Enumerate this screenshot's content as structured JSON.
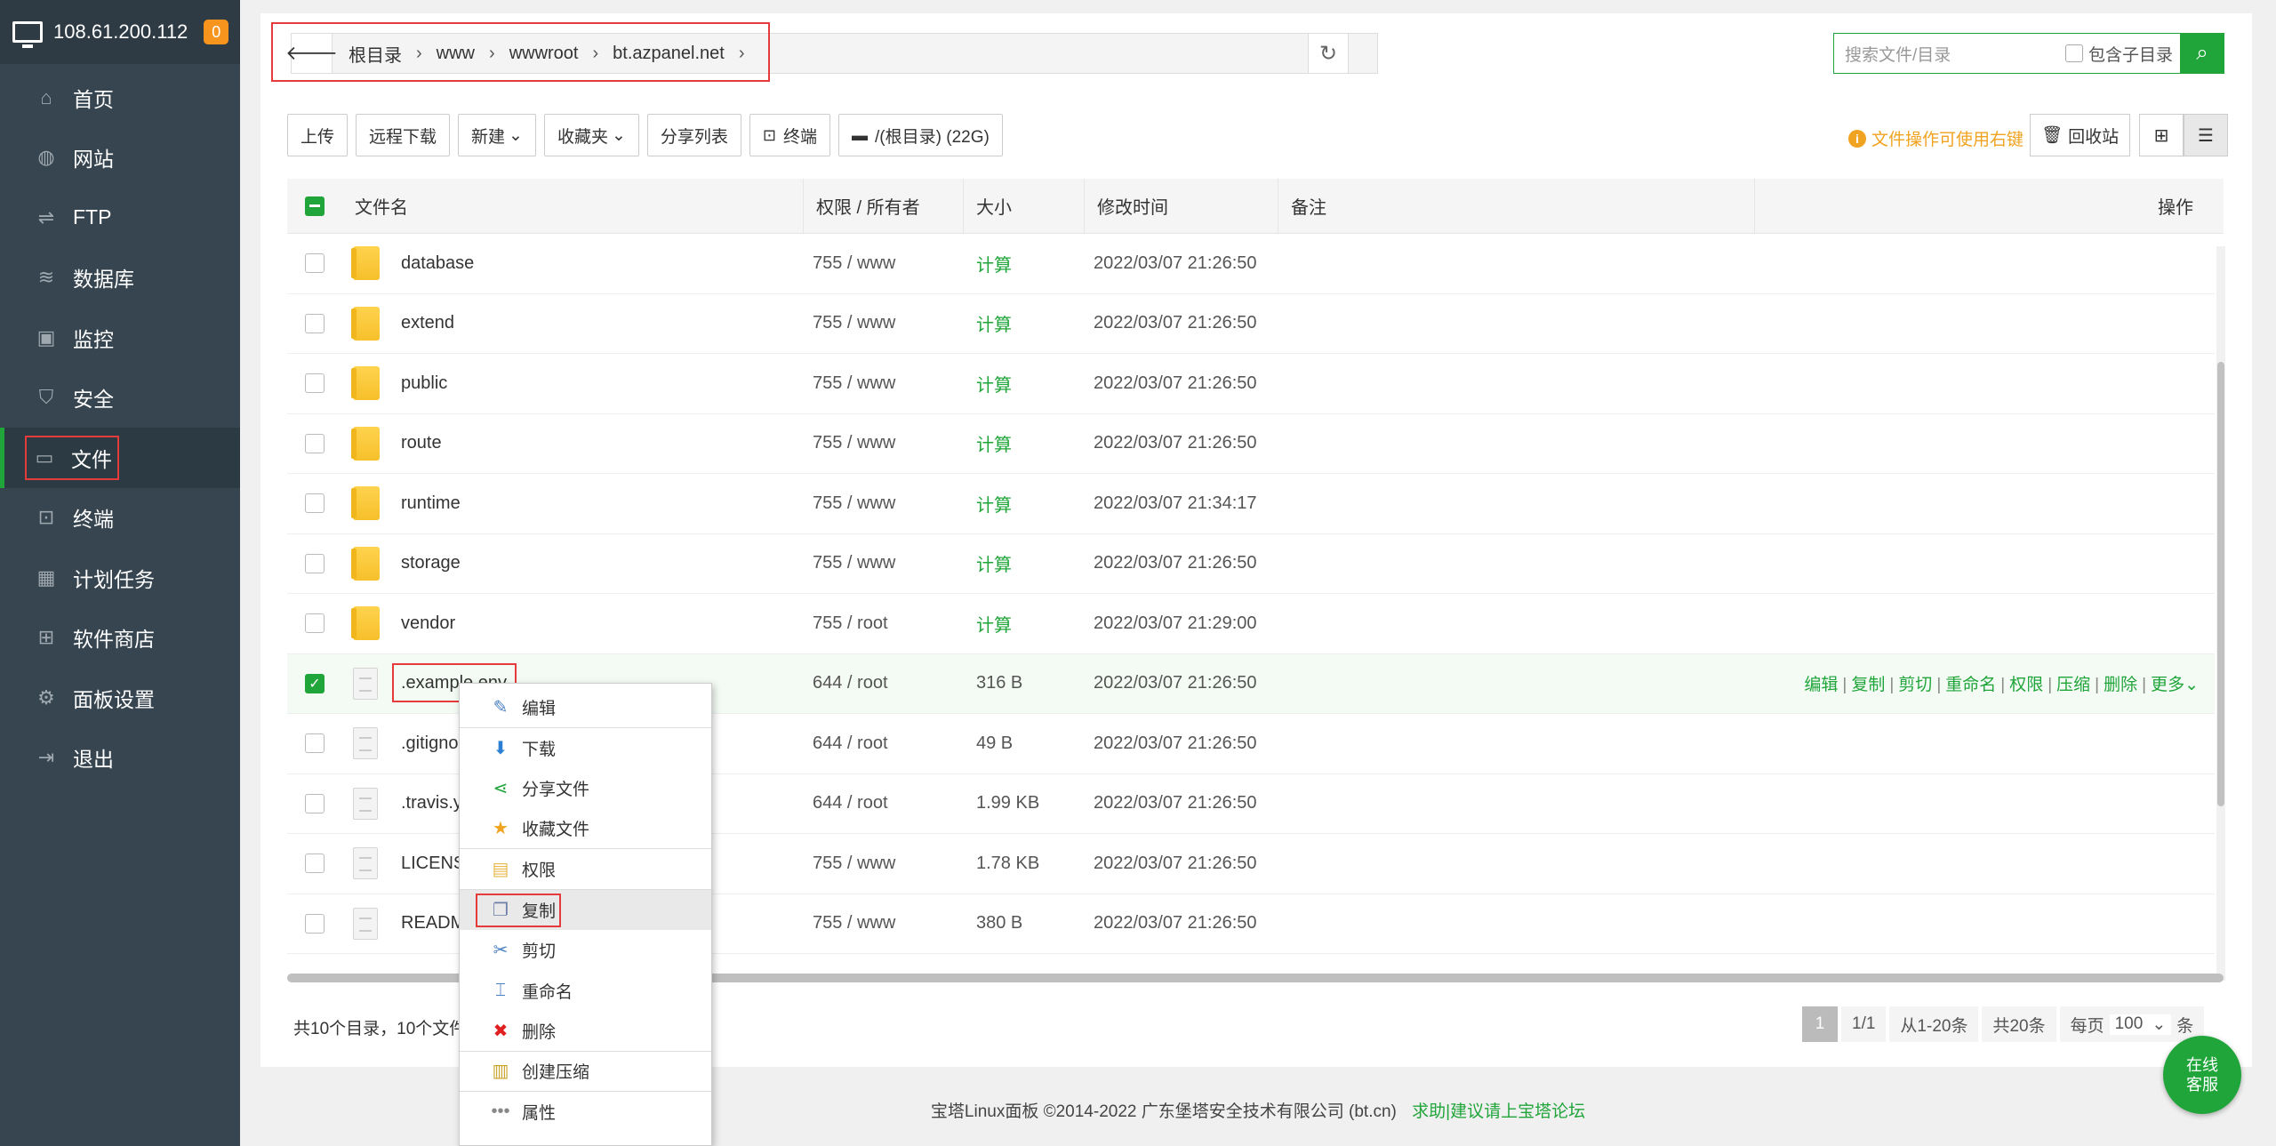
{
  "server": {
    "ip": "108.61.200.112",
    "badge": "0"
  },
  "sidebar": {
    "items": [
      {
        "label": "首页",
        "icon": "home-icon",
        "glyph": "⌂"
      },
      {
        "label": "网站",
        "icon": "globe-icon",
        "glyph": "◍"
      },
      {
        "label": "FTP",
        "icon": "ftp-icon",
        "glyph": "⇌"
      },
      {
        "label": "数据库",
        "icon": "database-icon",
        "glyph": "≋"
      },
      {
        "label": "监控",
        "icon": "monitor-icon",
        "glyph": "▣"
      },
      {
        "label": "安全",
        "icon": "shield-icon",
        "glyph": "⛉"
      },
      {
        "label": "文件",
        "icon": "folder-icon",
        "glyph": "▭"
      },
      {
        "label": "终端",
        "icon": "terminal-icon",
        "glyph": "⊡"
      },
      {
        "label": "计划任务",
        "icon": "calendar-icon",
        "glyph": "▦"
      },
      {
        "label": "软件商店",
        "icon": "grid-icon",
        "glyph": "⊞"
      },
      {
        "label": "面板设置",
        "icon": "gear-icon",
        "glyph": "⚙"
      },
      {
        "label": "退出",
        "icon": "logout-icon",
        "glyph": "⇥"
      }
    ]
  },
  "path": {
    "crumbs": [
      "根目录",
      "www",
      "wwwroot",
      "bt.azpanel.net"
    ],
    "sep": "›",
    "end": "›"
  },
  "search": {
    "placeholder": "搜索文件/目录",
    "subdir_label": "包含子目录"
  },
  "toolbar": {
    "upload": "上传",
    "remote_download": "远程下载",
    "new": "新建",
    "favorites": "收藏夹",
    "share_list": "分享列表",
    "terminal": "终端",
    "disk": "/(根目录) (22G)"
  },
  "tip": "文件操作可使用右键",
  "recycle": "回收站",
  "table": {
    "headers": {
      "name": "文件名",
      "perm": "权限 / 所有者",
      "size": "大小",
      "mtime": "修改时间",
      "note": "备注",
      "ops": "操作"
    },
    "rows": [
      {
        "name": "database",
        "type": "folder",
        "perm": "755 / www",
        "size": "计算",
        "mtime": "2022/03/07 21:26:50"
      },
      {
        "name": "extend",
        "type": "folder",
        "perm": "755 / www",
        "size": "计算",
        "mtime": "2022/03/07 21:26:50"
      },
      {
        "name": "public",
        "type": "folder",
        "perm": "755 / www",
        "size": "计算",
        "mtime": "2022/03/07 21:26:50"
      },
      {
        "name": "route",
        "type": "folder",
        "perm": "755 / www",
        "size": "计算",
        "mtime": "2022/03/07 21:26:50"
      },
      {
        "name": "runtime",
        "type": "folder",
        "perm": "755 / www",
        "size": "计算",
        "mtime": "2022/03/07 21:34:17"
      },
      {
        "name": "storage",
        "type": "folder",
        "perm": "755 / www",
        "size": "计算",
        "mtime": "2022/03/07 21:26:50"
      },
      {
        "name": "vendor",
        "type": "folder",
        "perm": "755 / root",
        "size": "计算",
        "mtime": "2022/03/07 21:29:00"
      },
      {
        "name": ".example.env",
        "type": "file",
        "perm": "644 / root",
        "size": "316 B",
        "mtime": "2022/03/07 21:26:50",
        "selected": true
      },
      {
        "name": ".gitignore",
        "type": "file",
        "perm": "644 / root",
        "size": "49 B",
        "mtime": "2022/03/07 21:26:50"
      },
      {
        "name": ".travis.yml",
        "type": "file",
        "perm": "644 / root",
        "size": "1.99 KB",
        "mtime": "2022/03/07 21:26:50"
      },
      {
        "name": "LICENSE.txt",
        "type": "file",
        "perm": "755 / www",
        "size": "1.78 KB",
        "mtime": "2022/03/07 21:26:50"
      },
      {
        "name": "README.md",
        "type": "file",
        "perm": "755 / www",
        "size": "380 B",
        "mtime": "2022/03/07 21:26:50"
      }
    ],
    "row_ops": [
      "编辑",
      "复制",
      "剪切",
      "重命名",
      "权限",
      "压缩",
      "删除",
      "更多"
    ]
  },
  "summary": "共10个目录，10个文件",
  "pager": {
    "current": "1",
    "pages": "1/1",
    "range": "从1-20条",
    "total": "共20条",
    "per_page_label": "每页",
    "per_page": "100",
    "unit": "条"
  },
  "context_menu": [
    {
      "label": "编辑",
      "icon": "edit-icon",
      "glyph": "✎",
      "color": "#4a7fc1"
    },
    {
      "label": "下载",
      "icon": "download-icon",
      "glyph": "⬇",
      "color": "#2a7fd4"
    },
    {
      "label": "分享文件",
      "icon": "share-icon",
      "glyph": "⋖",
      "color": "#20a53a"
    },
    {
      "label": "收藏文件",
      "icon": "star-icon",
      "glyph": "★",
      "color": "#f0a320"
    },
    {
      "label": "权限",
      "icon": "permission-icon",
      "glyph": "▤",
      "color": "#e8b84a"
    },
    {
      "label": "复制",
      "icon": "copy-icon",
      "glyph": "❐",
      "color": "#6b7fa8"
    },
    {
      "label": "剪切",
      "icon": "cut-icon",
      "glyph": "✂",
      "color": "#4a7fc1"
    },
    {
      "label": "重命名",
      "icon": "rename-icon",
      "glyph": "⌶",
      "color": "#4a7fc1"
    },
    {
      "label": "删除",
      "icon": "delete-icon",
      "glyph": "✖",
      "color": "#e02020"
    },
    {
      "label": "创建压缩",
      "icon": "archive-icon",
      "glyph": "▥",
      "color": "#c9a227"
    },
    {
      "label": "属性",
      "icon": "more-icon",
      "glyph": "•••",
      "color": "#888"
    }
  ],
  "footer": {
    "copyright": "宝塔Linux面板 ©2014-2022 广东堡塔安全技术有限公司 (bt.cn)",
    "link": "求助|建议请上宝塔论坛"
  },
  "service": {
    "line1": "在线",
    "line2": "客服"
  }
}
